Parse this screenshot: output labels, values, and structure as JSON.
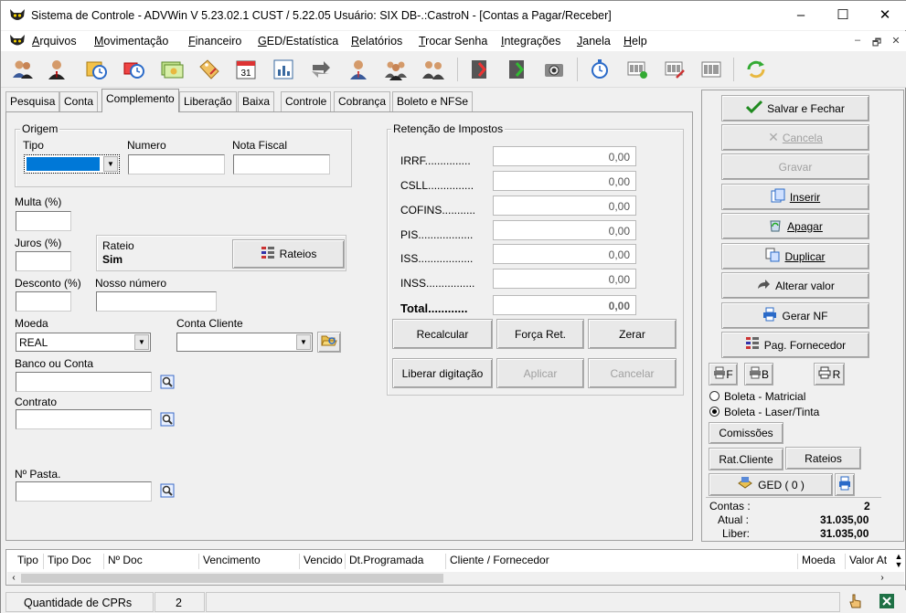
{
  "window": {
    "title": "Sistema de Controle - ADVWin  V 5.23.02.1 CUST / 5.22.05  Usuário: SIX  DB-.:CastroN - [Contas a Pagar/Receber]",
    "minimize": "–",
    "maximize": "☐",
    "close": "✕"
  },
  "menu": [
    {
      "u": "A",
      "rest": "rquivos"
    },
    {
      "u": "M",
      "rest": "ovimentação"
    },
    {
      "u": "F",
      "rest": "inanceiro"
    },
    {
      "u": "G",
      "rest": "ED/Estatística"
    },
    {
      "u": "R",
      "rest": "elatórios"
    },
    {
      "u": "T",
      "rest": "rocar Senha"
    },
    {
      "u": "I",
      "rest": "ntegrações"
    },
    {
      "u": "J",
      "rest": "anela"
    },
    {
      "u": "H",
      "rest": "elp"
    }
  ],
  "mdi": {
    "minimize": "–",
    "restore": "🗗",
    "close": "✕"
  },
  "tabs": [
    "Pesquisa",
    "Conta",
    "Complemento",
    "Liberação",
    "Baixa",
    "Controle",
    "Cobrança",
    "Boleto e NFSe"
  ],
  "active_tab": "Complemento",
  "origem": {
    "group": "Origem",
    "tipo_label": "Tipo",
    "numero_label": "Numero",
    "nota_label": "Nota Fiscal",
    "tipo_value": "",
    "numero_value": "",
    "nota_value": ""
  },
  "fields": {
    "multa_label": "Multa (%)",
    "juros_label": "Juros (%)",
    "desconto_label": "Desconto (%)",
    "nosso_label": "Nosso número",
    "rateio_label": "Rateio",
    "rateio_value": "Sim",
    "rateios_btn": "Rateios",
    "moeda_label": "Moeda",
    "moeda_value": "REAL",
    "conta_cliente_label": "Conta Cliente",
    "banco_label": "Banco ou Conta",
    "contrato_label": "Contrato",
    "pasta_label": "Nº Pasta."
  },
  "retencao": {
    "group": "Retenção de Impostos",
    "items": [
      {
        "label": "IRRF",
        "value": "0,00"
      },
      {
        "label": "CSLL",
        "value": "0,00"
      },
      {
        "label": "COFINS",
        "value": "0,00"
      },
      {
        "label": "PIS",
        "value": "0,00"
      },
      {
        "label": "ISS",
        "value": "0,00"
      },
      {
        "label": "INSS",
        "value": "0,00"
      }
    ],
    "total_label": "Total",
    "total_value": "0,00",
    "recalcular": "Recalcular",
    "forca": "Força Ret.",
    "zerar": "Zerar",
    "liberar": "Liberar digitação",
    "aplicar": "Aplicar",
    "cancelar": "Cancelar"
  },
  "actions": {
    "salvar": "Salvar e Fechar",
    "cancela": "Cancela",
    "gravar": "Gravar",
    "inserir": "Inserir",
    "apagar": "Apagar",
    "duplicar": "Duplicar",
    "alterar": "Alterar valor",
    "gerar_nf": "Gerar NF",
    "pag_fornecedor": "Pag. Fornecedor",
    "f": "F",
    "b": "B",
    "r": "R",
    "boleta_matricial": "Boleta - Matricial",
    "boleta_laser": "Boleta - Laser/Tinta",
    "comissoes": "Comissões",
    "rat_cliente": "Rat.Cliente",
    "rateios": "Rateios",
    "ged": "GED ( 0 )"
  },
  "totals": {
    "contas_label": "Contas :",
    "contas_value": "2",
    "atual_label": "Atual :",
    "atual_value": "31.035,00",
    "liber_label": "Liber:",
    "liber_value": "31.035,00"
  },
  "grid_columns": [
    "Tipo",
    "Tipo Doc",
    "Nº Doc",
    "Vencimento",
    "Vencido",
    "Dt.Programada",
    "Cliente / Fornecedor",
    "Moeda",
    "Valor At"
  ],
  "status": {
    "label": "Quantidade de CPRs",
    "count": "2"
  }
}
